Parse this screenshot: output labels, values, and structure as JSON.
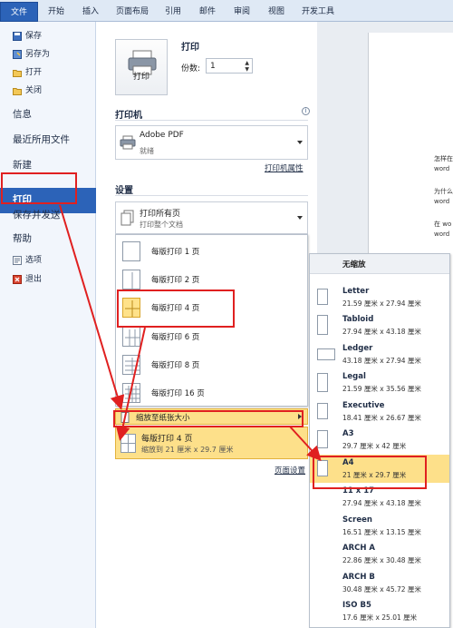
{
  "ribbon": {
    "tabs": [
      "文件",
      "开始",
      "插入",
      "页面布局",
      "引用",
      "邮件",
      "审阅",
      "视图",
      "开发工具"
    ]
  },
  "nav": {
    "save": "保存",
    "save_as": "另存为",
    "open": "打开",
    "close": "关闭",
    "info": "信息",
    "recent": "最近所用文件",
    "new": "新建",
    "print": "打印",
    "save_send": "保存并发送",
    "help": "帮助",
    "options": "选项",
    "exit": "退出"
  },
  "print": {
    "title": "打印",
    "button_label": "打印",
    "copies_label": "份数:",
    "copies_value": "1"
  },
  "printer": {
    "section": "打印机",
    "name": "Adobe PDF",
    "status": "就绪",
    "properties_link": "打印机属性"
  },
  "settings": {
    "section": "设置",
    "range_title": "打印所有页",
    "range_sub": "打印整个文档",
    "pages_per_sheet_options": [
      "每版打印 1 页",
      "每版打印 2 页",
      "每版打印 4 页",
      "每版打印 6 页",
      "每版打印 8 页",
      "每版打印 16 页"
    ],
    "scale_to_paper": "缩放至纸张大小",
    "pps_current_title": "每版打印 4 页",
    "pps_current_sub": "缩放到 21 厘米 x 29.7 厘米",
    "page_setup_link": "页面设置"
  },
  "paper_menu": {
    "header": "无缩放",
    "items": [
      {
        "name": "Letter",
        "dims": "21.59 厘米 x 27.94 厘米"
      },
      {
        "name": "Tabloid",
        "dims": "27.94 厘米 x 43.18 厘米"
      },
      {
        "name": "Ledger",
        "dims": "43.18 厘米 x 27.94 厘米"
      },
      {
        "name": "Legal",
        "dims": "21.59 厘米 x 35.56 厘米"
      },
      {
        "name": "Executive",
        "dims": "18.41 厘米 x 26.67 厘米"
      },
      {
        "name": "A3",
        "dims": "29.7 厘米 x 42 厘米"
      },
      {
        "name": "A4",
        "dims": "21 厘米 x 29.7 厘米"
      },
      {
        "name": "11 x 17",
        "dims": "27.94 厘米 x 43.18 厘米"
      },
      {
        "name": "Screen",
        "dims": "16.51 厘米 x 13.15 厘米"
      },
      {
        "name": "ARCH A",
        "dims": "22.86 厘米 x 30.48 厘米"
      },
      {
        "name": "ARCH B",
        "dims": "30.48 厘米 x 45.72 厘米"
      },
      {
        "name": "ISO B5",
        "dims": "17.6 厘米 x 25.01 厘米"
      }
    ]
  },
  "preview": {
    "lines": [
      "怎样在",
      "word",
      "为什么",
      "word",
      "在 wo",
      "word"
    ]
  },
  "colors": {
    "accent": "#2c63b8",
    "highlight": "#fde08a",
    "annotation": "#e02020"
  }
}
